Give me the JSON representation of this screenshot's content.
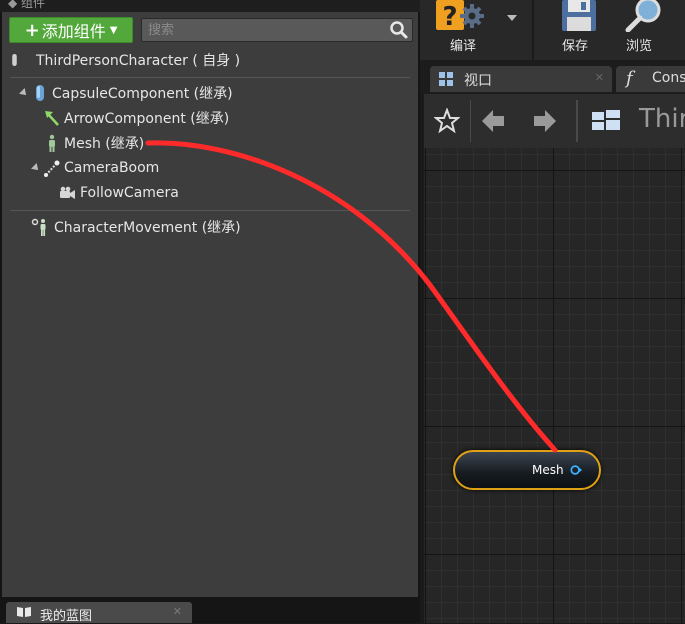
{
  "components_panel": {
    "add_button_label": "添加组件",
    "search_placeholder": "搜索",
    "root_item": "ThirdPersonCharacter ( 自身 )",
    "tree": [
      {
        "label": "CapsuleComponent (继承)"
      },
      {
        "label": "ArrowComponent (继承)"
      },
      {
        "label": "Mesh (继承)"
      },
      {
        "label": "CameraBoom"
      },
      {
        "label": "FollowCamera"
      },
      {
        "label": "CharacterMovement (继承)"
      }
    ]
  },
  "bottom_tab": {
    "label": "我的蓝图"
  },
  "toolbar": {
    "compile_label": "编译",
    "save_label": "保存",
    "browse_label": "浏览"
  },
  "tabs": [
    {
      "label": "视口"
    },
    {
      "label": "Cons"
    }
  ],
  "viewport": {
    "title": "Third"
  },
  "graph": {
    "node_label": "Mesh"
  },
  "colors": {
    "add_button": "#52a83a",
    "node_border": "#e0a013",
    "wire": "#ff2b2b",
    "pin": "#3ab0ff"
  }
}
